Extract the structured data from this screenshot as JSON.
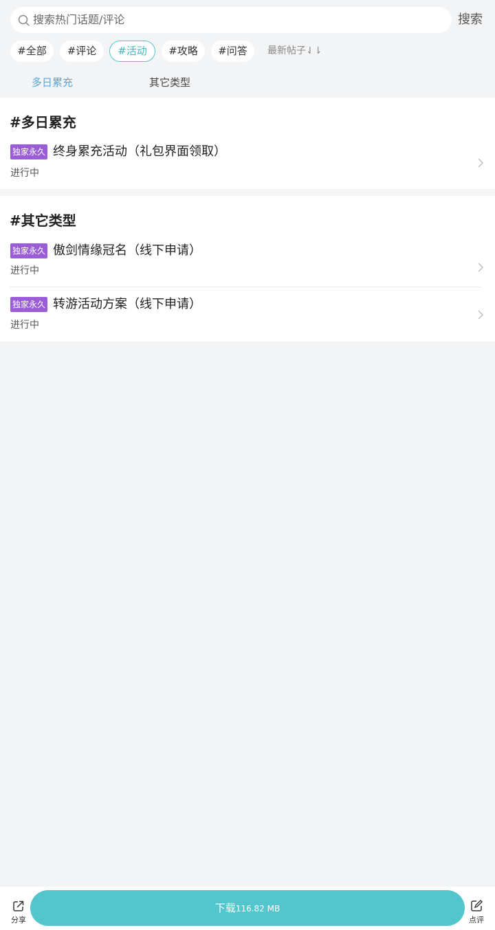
{
  "search": {
    "placeholder": "搜索热门话题/评论",
    "button_label": "搜索"
  },
  "tags": [
    {
      "label": "#全部",
      "active": false
    },
    {
      "label": "#评论",
      "active": false
    },
    {
      "label": "#活动",
      "active": true
    },
    {
      "label": "#攻略",
      "active": false
    },
    {
      "label": "#问答",
      "active": false
    }
  ],
  "sort": {
    "label": "最新帖子⇃⇂"
  },
  "subtabs": [
    {
      "label": "多日累充",
      "active": true
    },
    {
      "label": "其它类型",
      "active": false
    }
  ],
  "sections": [
    {
      "title": "#多日累充",
      "items": [
        {
          "badge": "独家永久",
          "title": "终身累充活动（礼包界面领取）",
          "status": "进行中"
        }
      ]
    },
    {
      "title": "#其它类型",
      "items": [
        {
          "badge": "独家永久",
          "title": "傲剑情缘冠名（线下申请）",
          "status": "进行中"
        },
        {
          "badge": "独家永久",
          "title": "转游活动方案（线下申请）",
          "status": "进行中"
        }
      ]
    }
  ],
  "bottom_bar": {
    "share_label": "分享",
    "download_label": "下载",
    "download_size": "116.82 MB",
    "review_label": "点评"
  },
  "colors": {
    "accent": "#53c5cd",
    "badge": "#9b5cd8",
    "active_subtab": "#5aa6d9",
    "background": "#f3f4f6"
  }
}
